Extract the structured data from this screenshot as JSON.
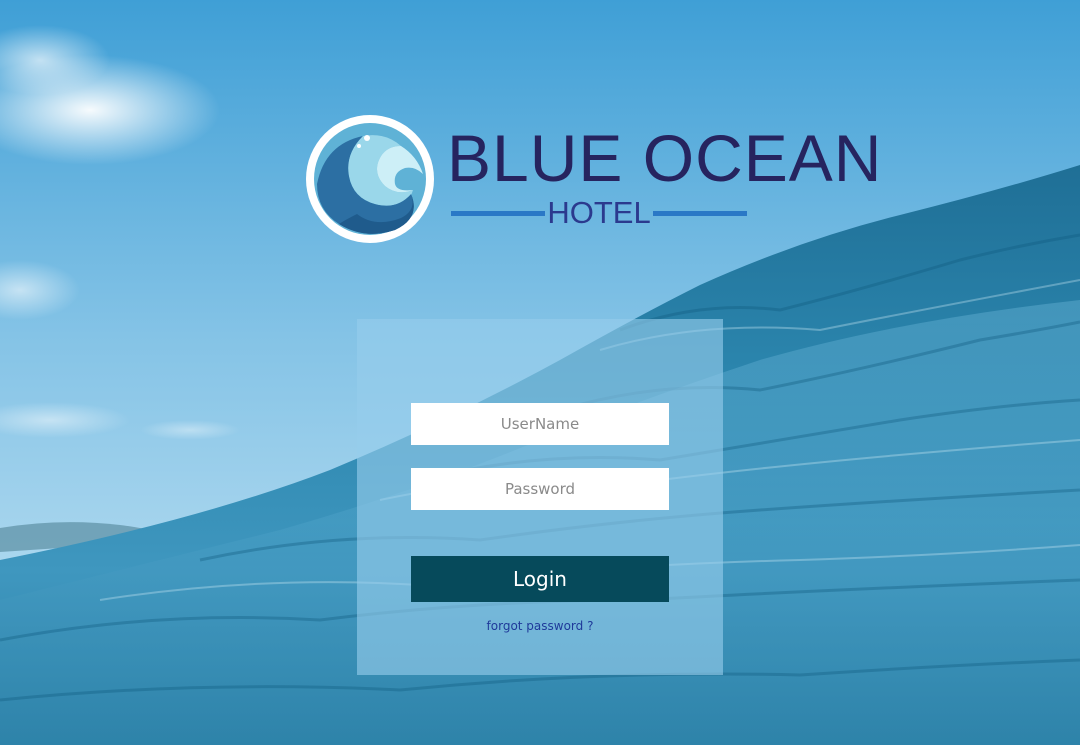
{
  "brand": {
    "name": "BLUE OCEAN",
    "subtitle": "HOTEL",
    "colors": {
      "name": "#26245f",
      "subtitle": "#2b3a8e",
      "divider": "#2a78c6"
    },
    "emblem_icon": "ocean-wave-icon"
  },
  "login": {
    "username_placeholder": "UserName",
    "username_value": "",
    "password_placeholder": "Password",
    "password_value": "",
    "button_label": "Login",
    "forgot_label": "forgot password ?",
    "colors": {
      "button_bg": "#064a5b",
      "panel_bg": "#96cdeb",
      "link": "#1f3a9a"
    }
  },
  "background": {
    "description_icon": "ocean-background-image"
  }
}
